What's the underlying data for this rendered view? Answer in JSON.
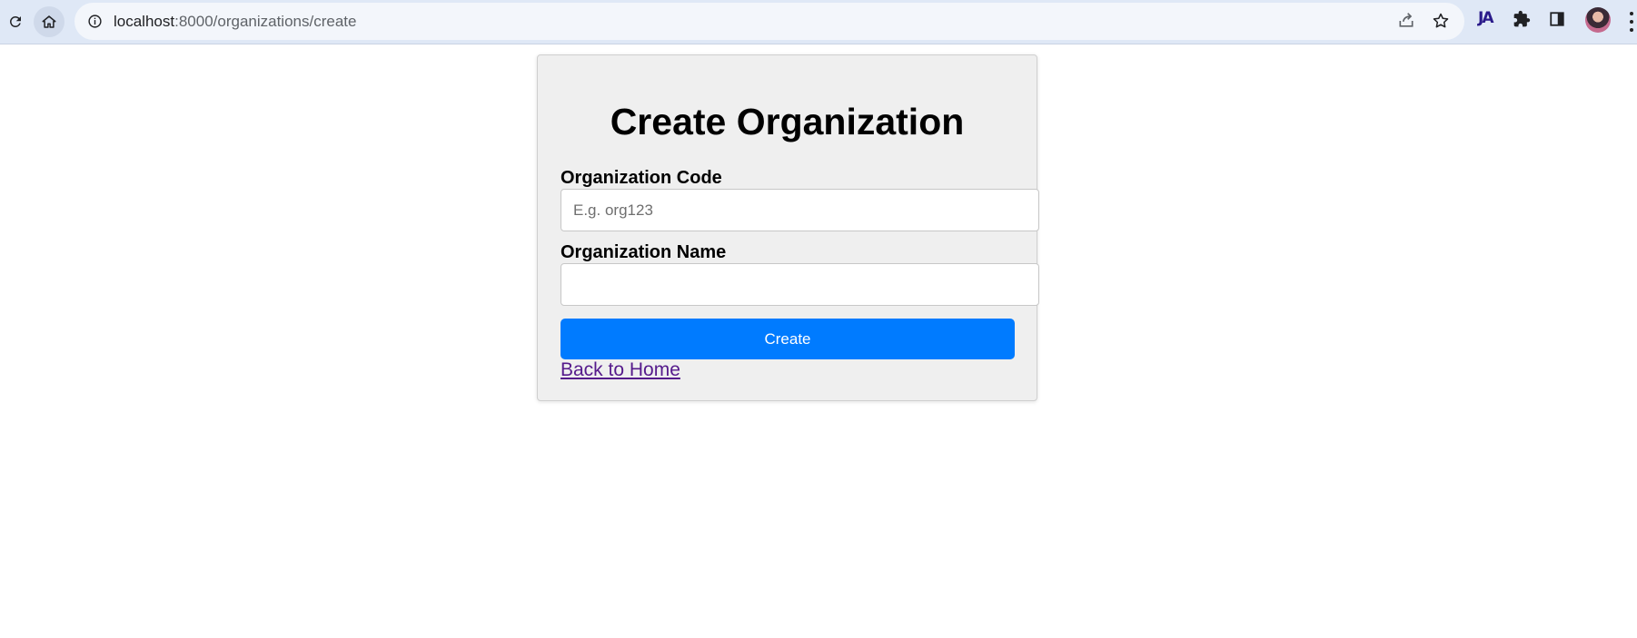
{
  "browser": {
    "url_host": "localhost",
    "url_path": ":8000/organizations/create",
    "extension_label": "JA",
    "icons": [
      "reload-icon",
      "home-icon",
      "info-icon",
      "share-icon",
      "star-icon",
      "extensions-icon",
      "side-panel-icon",
      "profile-avatar",
      "menu-icon"
    ]
  },
  "form": {
    "title": "Create Organization",
    "code_label": "Organization Code",
    "code_placeholder": "E.g. org123",
    "code_value": "",
    "name_label": "Organization Name",
    "name_value": "",
    "submit_label": "Create",
    "back_link": "Back to Home"
  },
  "colors": {
    "accent": "#007bff",
    "card_bg": "#efefef",
    "link_visited": "#551a8b"
  }
}
